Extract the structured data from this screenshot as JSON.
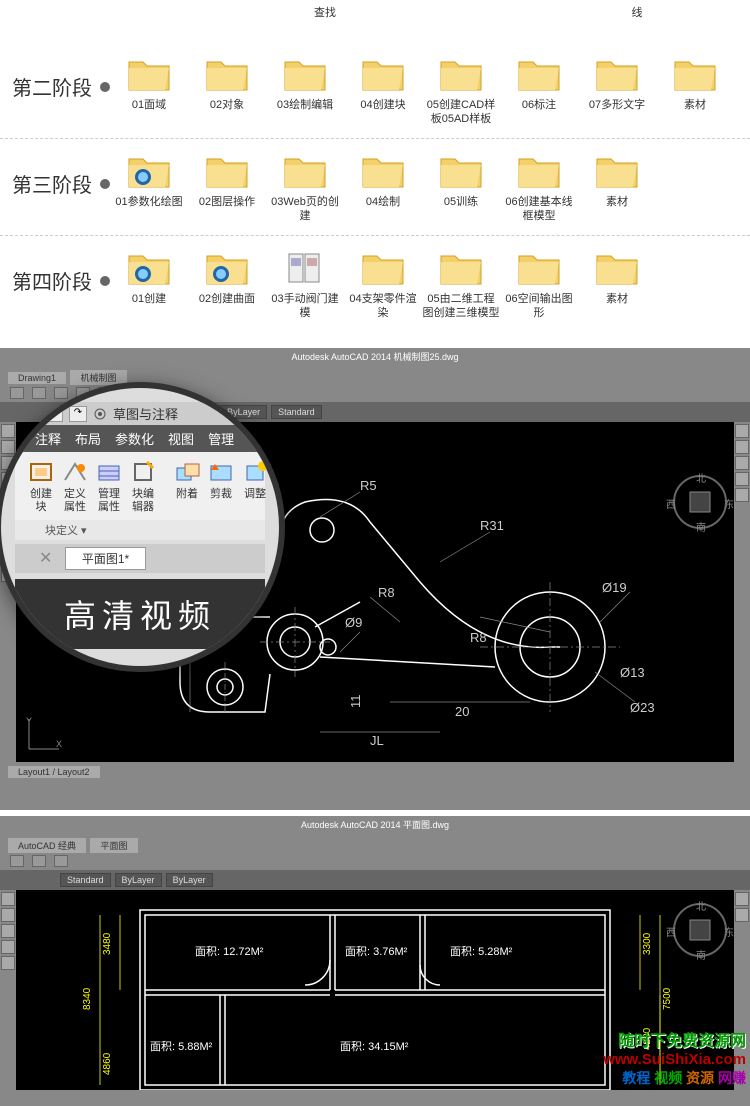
{
  "top_partial": {
    "items": [
      {
        "label": "查找",
        "col": 2
      },
      {
        "label": "线",
        "col": 6
      }
    ]
  },
  "stages": [
    {
      "title": "第二阶段",
      "folders": [
        {
          "label": "01面域"
        },
        {
          "label": "02对象"
        },
        {
          "label": "03绘制编辑"
        },
        {
          "label": "04创建块"
        },
        {
          "label": "05创建CAD样板05AD样板"
        },
        {
          "label": "06标注"
        },
        {
          "label": "07多形文字"
        },
        {
          "label": "素材"
        }
      ]
    },
    {
      "title": "第三阶段",
      "folders": [
        {
          "label": "01参数化绘图",
          "special": true
        },
        {
          "label": "02图层操作"
        },
        {
          "label": "03Web页的创建"
        },
        {
          "label": "04绘制"
        },
        {
          "label": "05训练"
        },
        {
          "label": "06创建基本线框模型"
        },
        {
          "label": "素材"
        }
      ]
    },
    {
      "title": "第四阶段",
      "folders": [
        {
          "label": "01创建",
          "special": true
        },
        {
          "label": "02创建曲面",
          "special": true
        },
        {
          "label": "03手动阀门建模",
          "special2": true
        },
        {
          "label": "04支架零件渲染"
        },
        {
          "label": "05由二维工程图创建三维模型"
        },
        {
          "label": "06空间输出图形"
        },
        {
          "label": "素材"
        }
      ]
    }
  ],
  "cad1": {
    "title": "Autodesk AutoCAD 2014  机械制图25.dwg",
    "tab": "Drawing1",
    "tab2": "机械制图",
    "bottom_tabs": "Layout1 / Layout2",
    "ribbon_items": [
      "Standard",
      "Standard",
      "ByLayer",
      "ByLayer",
      "Standard"
    ],
    "compass": {
      "n": "北",
      "s": "南",
      "e": "东",
      "w": "西"
    },
    "dims": {
      "r5": "R5",
      "r31": "R31",
      "r8_1": "R8",
      "r8_2": "R8",
      "d9": "Ø9",
      "d19": "Ø19",
      "d13": "Ø13",
      "d23": "Ø23",
      "d20": "20",
      "d11": "11",
      "jl": "JL",
      "d8": "8"
    }
  },
  "magnifier": {
    "barlabel": "草图与注释",
    "tabs": [
      "注释",
      "布局",
      "参数化",
      "视图",
      "管理"
    ],
    "ribbon": [
      {
        "label": "创建块"
      },
      {
        "label": "定义属性"
      },
      {
        "label": "管理属性"
      },
      {
        "label": "块编辑器"
      },
      {
        "label": "附着"
      },
      {
        "label": "剪裁"
      },
      {
        "label": "调整"
      }
    ],
    "subbar": "块定义 ▾",
    "doctab": "平面图1*",
    "footer": "高清视频"
  },
  "cad2": {
    "title": "Autodesk AutoCAD 2014  平面图.dwg",
    "tab": "AutoCAD 经典",
    "tab2": "平面图",
    "rooms": {
      "r1": "面积: 12.72M²",
      "r2": "面积: 3.76M²",
      "r3": "面积: 5.28M²",
      "r4": "面积: 5.88M²",
      "r5": "面积: 34.15M²"
    },
    "dims": {
      "d1": "3480",
      "d2": "8340",
      "d3": "4860",
      "d4": "3300",
      "d5": "7500",
      "d6": "4200"
    }
  },
  "watermark": {
    "line1": "随时下免费资源网",
    "line2": "www.SuiShiXia.com",
    "w1": "教程",
    "w2": "视频",
    "w3": "资源",
    "w4": "网赚"
  }
}
